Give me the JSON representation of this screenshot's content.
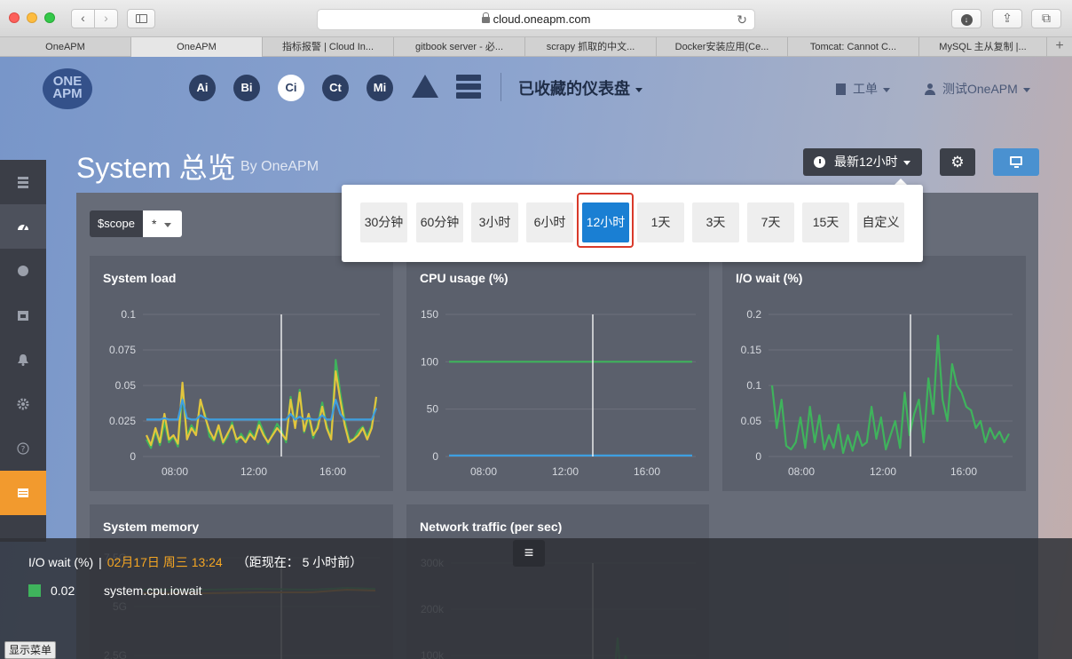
{
  "browser": {
    "url": "cloud.oneapm.com",
    "reload_glyph": "↻",
    "back_glyph": "‹",
    "forward_glyph": "›",
    "share_glyph": "⇪",
    "tabs_glyph": "⧉",
    "download_glyph": "↓",
    "plus_glyph": "+",
    "tabs": [
      {
        "label": "OneAPM",
        "active": false
      },
      {
        "label": "OneAPM",
        "active": true
      },
      {
        "label": "指标报警 | Cloud In...",
        "active": false
      },
      {
        "label": "gitbook server - 必...",
        "active": false
      },
      {
        "label": "scrapy 抓取的中文...",
        "active": false
      },
      {
        "label": "Docker安装应用(Ce...",
        "active": false
      },
      {
        "label": "Tomcat: Cannot C...",
        "active": false
      },
      {
        "label": "MySQL 主从复制 |...",
        "active": false
      }
    ]
  },
  "nav": {
    "logo_line1": "ONE",
    "logo_line2": "APM",
    "products": [
      "Ai",
      "Bi",
      "Ci",
      "Ct",
      "Mi"
    ],
    "active_product": "Ci",
    "dashboards_label": "已收藏的仪表盘",
    "workorder_label": "工单",
    "user_label": "测试OneAPM"
  },
  "page": {
    "title": "System 总览",
    "subtitle": "By OneAPM",
    "time_range_label": "最新12小时",
    "settings_glyph": "⚙"
  },
  "filter": {
    "scope_label": "$scope",
    "scope_value": "*"
  },
  "time_ranges": [
    "30分钟",
    "60分钟",
    "3小时",
    "6小时",
    "12小时",
    "1天",
    "3天",
    "7天",
    "15天",
    "自定义"
  ],
  "selected_time_range": "12小时",
  "colors": {
    "green": "#3fb35c",
    "yellow": "#e3c53d",
    "blue": "#3e9fe0",
    "orange": "#f29a2e",
    "selected": "#1a7fd3",
    "highlight": "#d93a2b",
    "tooltip_date": "#f5a623"
  },
  "charts": {
    "system_load": {
      "title": "System load",
      "yticks": [
        "0.1",
        "0.075",
        "0.05",
        "0.025",
        "0"
      ],
      "xticks": [
        "08:00",
        "12:00",
        "16:00"
      ]
    },
    "cpu_usage": {
      "title": "CPU usage (%)",
      "yticks": [
        "150",
        "100",
        "50",
        "0"
      ],
      "xticks": [
        "08:00",
        "12:00",
        "16:00"
      ]
    },
    "io_wait": {
      "title": "I/O wait (%)",
      "yticks": [
        "0.2",
        "0.15",
        "0.1",
        "0.05",
        "0"
      ],
      "xticks": [
        "08:00",
        "12:00",
        "16:00"
      ]
    },
    "system_memory": {
      "title": "System memory",
      "yticks": [
        "7.5G",
        "5G",
        "2.5G"
      ]
    },
    "network_traffic": {
      "title": "Network traffic (per sec)",
      "yticks": [
        "300k",
        "200k",
        "100k"
      ]
    }
  },
  "chart_data": [
    {
      "type": "line",
      "title": "System load",
      "ylim": [
        0,
        0.1
      ],
      "x_range": [
        "06:00",
        "18:00"
      ],
      "series": [
        {
          "values": [
            0.012,
            0.006,
            0.018,
            0.008,
            0.024,
            0.01,
            0.014,
            0.007,
            0.044,
            0.015,
            0.022,
            0.017,
            0.038,
            0.03,
            0.014,
            0.011,
            0.02,
            0.009,
            0.014,
            0.024,
            0.01,
            0.016,
            0.011,
            0.018,
            0.013,
            0.025,
            0.017,
            0.009,
            0.016,
            0.023,
            0.018,
            0.01,
            0.042,
            0.022,
            0.047,
            0.017,
            0.028,
            0.013,
            0.022,
            0.038,
            0.022,
            0.013,
            0.068,
            0.045,
            0.025,
            0.012,
            0.012,
            0.018,
            0.021,
            0.014,
            0.022,
            0.04
          ]
        },
        {
          "values": [
            0.015,
            0.008,
            0.02,
            0.01,
            0.03,
            0.012,
            0.015,
            0.009,
            0.052,
            0.012,
            0.02,
            0.015,
            0.04,
            0.028,
            0.018,
            0.012,
            0.022,
            0.01,
            0.016,
            0.022,
            0.012,
            0.014,
            0.01,
            0.016,
            0.012,
            0.022,
            0.015,
            0.01,
            0.015,
            0.02,
            0.016,
            0.012,
            0.04,
            0.02,
            0.045,
            0.018,
            0.03,
            0.015,
            0.02,
            0.035,
            0.02,
            0.012,
            0.06,
            0.04,
            0.022,
            0.01,
            0.012,
            0.015,
            0.02,
            0.012,
            0.02,
            0.042
          ]
        },
        {
          "values": [
            0.026,
            0.026,
            0.026,
            0.026,
            0.027,
            0.026,
            0.026,
            0.026,
            0.04,
            0.027,
            0.026,
            0.026,
            0.029,
            0.027,
            0.026,
            0.026,
            0.026,
            0.026,
            0.026,
            0.026,
            0.026,
            0.026,
            0.026,
            0.026,
            0.026,
            0.026,
            0.026,
            0.026,
            0.026,
            0.026,
            0.026,
            0.026,
            0.03,
            0.026,
            0.028,
            0.026,
            0.027,
            0.026,
            0.026,
            0.029,
            0.026,
            0.026,
            0.04,
            0.03,
            0.026,
            0.026,
            0.026,
            0.026,
            0.026,
            0.026,
            0.026,
            0.034
          ]
        }
      ]
    },
    {
      "type": "line",
      "title": "CPU usage (%)",
      "ylim": [
        0,
        150
      ],
      "x_range": [
        "06:00",
        "18:00"
      ],
      "series": [
        {
          "values": [
            100,
            100,
            100,
            100,
            100,
            100,
            100,
            100,
            100,
            100,
            100,
            100,
            100,
            100,
            100,
            100
          ]
        },
        {
          "values": [
            1,
            1,
            1,
            1,
            1,
            1,
            1,
            1,
            1,
            1,
            1,
            1,
            1,
            1,
            1,
            1
          ]
        }
      ]
    },
    {
      "type": "line",
      "title": "I/O wait (%)",
      "ylim": [
        0,
        0.2
      ],
      "x_range": [
        "06:00",
        "18:00"
      ],
      "series": [
        {
          "values": [
            0.1,
            0.04,
            0.08,
            0.015,
            0.01,
            0.02,
            0.055,
            0.012,
            0.07,
            0.02,
            0.058,
            0.01,
            0.03,
            0.012,
            0.045,
            0.005,
            0.03,
            0.008,
            0.035,
            0.015,
            0.02,
            0.07,
            0.025,
            0.055,
            0.01,
            0.03,
            0.05,
            0.012,
            0.09,
            0.03,
            0.06,
            0.08,
            0.02,
            0.11,
            0.06,
            0.17,
            0.08,
            0.05,
            0.13,
            0.1,
            0.09,
            0.07,
            0.065,
            0.04,
            0.05,
            0.02,
            0.04,
            0.025,
            0.035,
            0.02,
            0.032
          ]
        }
      ]
    }
  ],
  "tooltip": {
    "chart_label": "I/O wait (%)",
    "separator": "|",
    "date": "02月17日 周三 13:24",
    "ago_prefix": "（距现在：",
    "ago_value": "5 小时前）",
    "value": "0.02",
    "metric": "system.cpu.iowait",
    "menu_glyph": "≡"
  },
  "show_menu_label": "显示菜单"
}
